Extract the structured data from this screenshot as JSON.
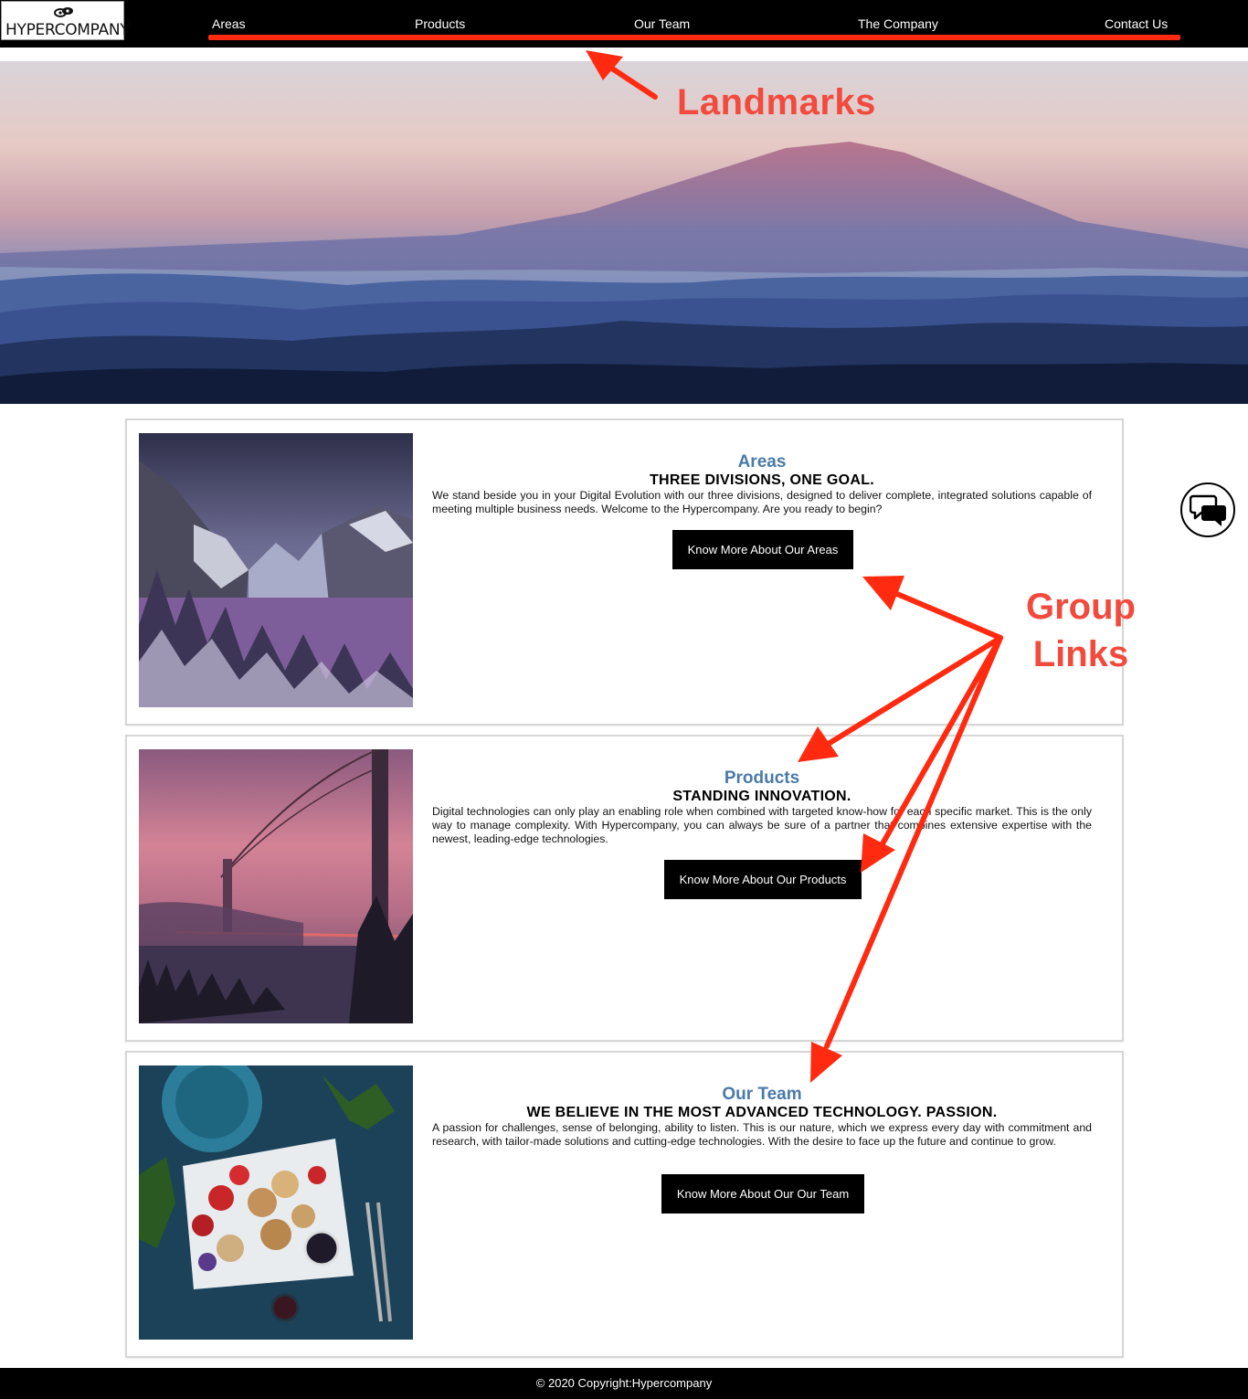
{
  "header": {
    "logo_text": "HYPERCOMPANY",
    "nav": [
      {
        "label": "Areas"
      },
      {
        "label": "Products"
      },
      {
        "label": "Our Team"
      },
      {
        "label": "The Company"
      },
      {
        "label": "Contact Us"
      }
    ],
    "accent_color": "#ff2a10"
  },
  "sections": [
    {
      "title": "Areas",
      "subtitle": "THREE DIVISIONS, ONE GOAL.",
      "text": "We stand beside you in your Digital Evolution with our three divisions, designed to deliver complete, integrated solutions capable of meeting multiple business needs. Welcome to the Hypercompany. Are you ready to begin?",
      "button": "Know More About Our Areas"
    },
    {
      "title": "Products",
      "subtitle": "STANDING INNOVATION.",
      "text": "Digital technologies can only play an enabling role when combined with targeted know-how for each specific market. This is the only way to manage complexity. With Hypercompany, you can always be sure of a partner that combines extensive expertise with the newest, leading-edge technologies.",
      "button": "Know More About Our Products"
    },
    {
      "title": "Our Team",
      "subtitle": "WE BELIEVE IN THE MOST ADVANCED TECHNOLOGY. PASSION.",
      "text": "A passion for challenges, sense of belonging, ability to listen. This is our nature, which we express every day with commitment and research, with tailor-made solutions and cutting-edge technologies. With the desire to face up the future and continue to grow.",
      "button": "Know More About Our Our Team"
    }
  ],
  "annotations": {
    "landmarks": "Landmarks",
    "group_links_line1": "Group",
    "group_links_line2": "Links",
    "color": "#f24a3c"
  },
  "footer": {
    "copyright": "© 2020  Copyright:Hypercompany"
  },
  "icons": {
    "chat": "chat-bubbles-icon",
    "logo": "logo-mark-icon"
  },
  "colors": {
    "section_title": "#4a7aa8",
    "button_bg": "#000000",
    "topbar_bg": "#000000"
  }
}
